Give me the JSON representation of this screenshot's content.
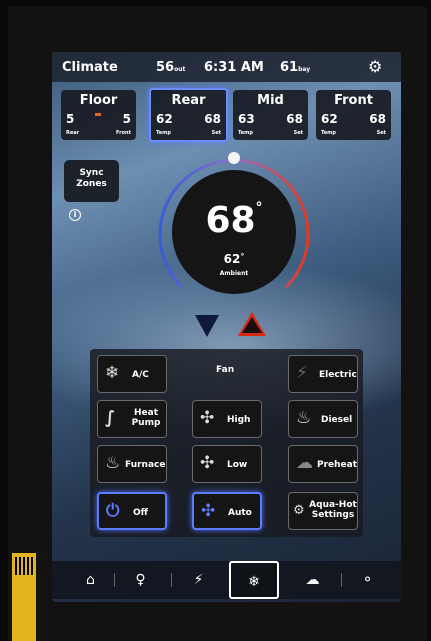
{
  "topbar": {
    "title": "Climate",
    "outside_temp": "56",
    "outside_label": "out",
    "time": "6:31 AM",
    "inside_temp": "61",
    "inside_label": "bay"
  },
  "zones": [
    {
      "name": "Floor",
      "left_value": "5",
      "right_value": "5",
      "left_label": "Rear",
      "right_label": "Front"
    },
    {
      "name": "Rear",
      "left_value": "62",
      "right_value": "68",
      "left_label": "Temp",
      "right_label": "Set"
    },
    {
      "name": "Mid",
      "left_value": "63",
      "right_value": "68",
      "left_label": "Temp",
      "right_label": "Set"
    },
    {
      "name": "Front",
      "left_value": "62",
      "right_value": "68",
      "left_label": "Temp",
      "right_label": "Set"
    }
  ],
  "sync": {
    "label_line1": "Sync",
    "label_line2": "Zones",
    "info": "i"
  },
  "dial": {
    "setpoint": "68",
    "degree": "°",
    "ambient_value": "62",
    "ambient_label": "Ambient"
  },
  "modes": {
    "fan_label": "Fan",
    "ac": "A/C",
    "electric": "Electric",
    "heat_pump_1": "Heat",
    "heat_pump_2": "Pump",
    "fan_high": "High",
    "diesel": "Diesel",
    "furnace": "Furnace",
    "fan_low": "Low",
    "preheat": "Preheat",
    "off": "Off",
    "fan_auto": "Auto",
    "aquahot_1": "Aqua-Hot",
    "aquahot_2": "Settings"
  },
  "icons": {
    "snowflake": "❄",
    "bolt": "⚡",
    "heat": "∫",
    "fan": "✣",
    "flame": "♨",
    "power": "⏻",
    "gear": "⚙",
    "home": "⌂",
    "bulb": "♀",
    "cloud": "☁",
    "nav_last": "⚬"
  },
  "colors": {
    "accent_blue": "#5c7cff",
    "heat_red": "#d62a12",
    "cool_navy": "#0f1a3a"
  }
}
